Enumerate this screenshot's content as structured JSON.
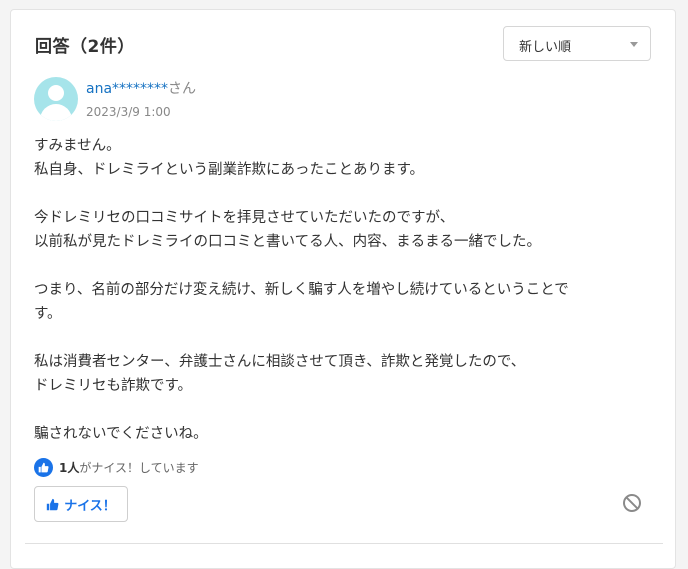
{
  "header": {
    "title": "回答（2件）"
  },
  "sort": {
    "selected": "新しい順"
  },
  "answer": {
    "user_name": "ana********",
    "user_suffix": "さん",
    "date": "2023/3/9 1:00",
    "paragraphs": [
      {
        "line1": "すみません。",
        "line2": "私自身、ドレミライという副業詐欺にあったことあります。"
      },
      {
        "line1": "今ドレミリセの口コミサイトを拝見させていただいたのですが、",
        "line2": "以前私が見たドレミライの口コミと書いてる人、内容、まるまる一緒でした。"
      },
      {
        "line1": "つまり、名前の部分だけ変え続け、新しく騙す人を増やし続けているということで",
        "line2": "す。"
      },
      {
        "line1": "私は消費者センター、弁護士さんに相談させて頂き、詐欺と発覚したので、",
        "line2": "ドレミリセも詐欺です。"
      },
      {
        "line1": "騙されないでくださいね。"
      }
    ],
    "likes": {
      "count": "1人",
      "suffix": "がナイス！しています"
    },
    "nice_button": "ナイス！"
  },
  "colors": {
    "accent": "#1a73e8",
    "link": "#1672c2",
    "avatar": "#a6e4ea"
  },
  "icons": {
    "like": "thumbs-up-icon",
    "report": "prohibited-icon",
    "sort": "chevron-down-icon"
  }
}
